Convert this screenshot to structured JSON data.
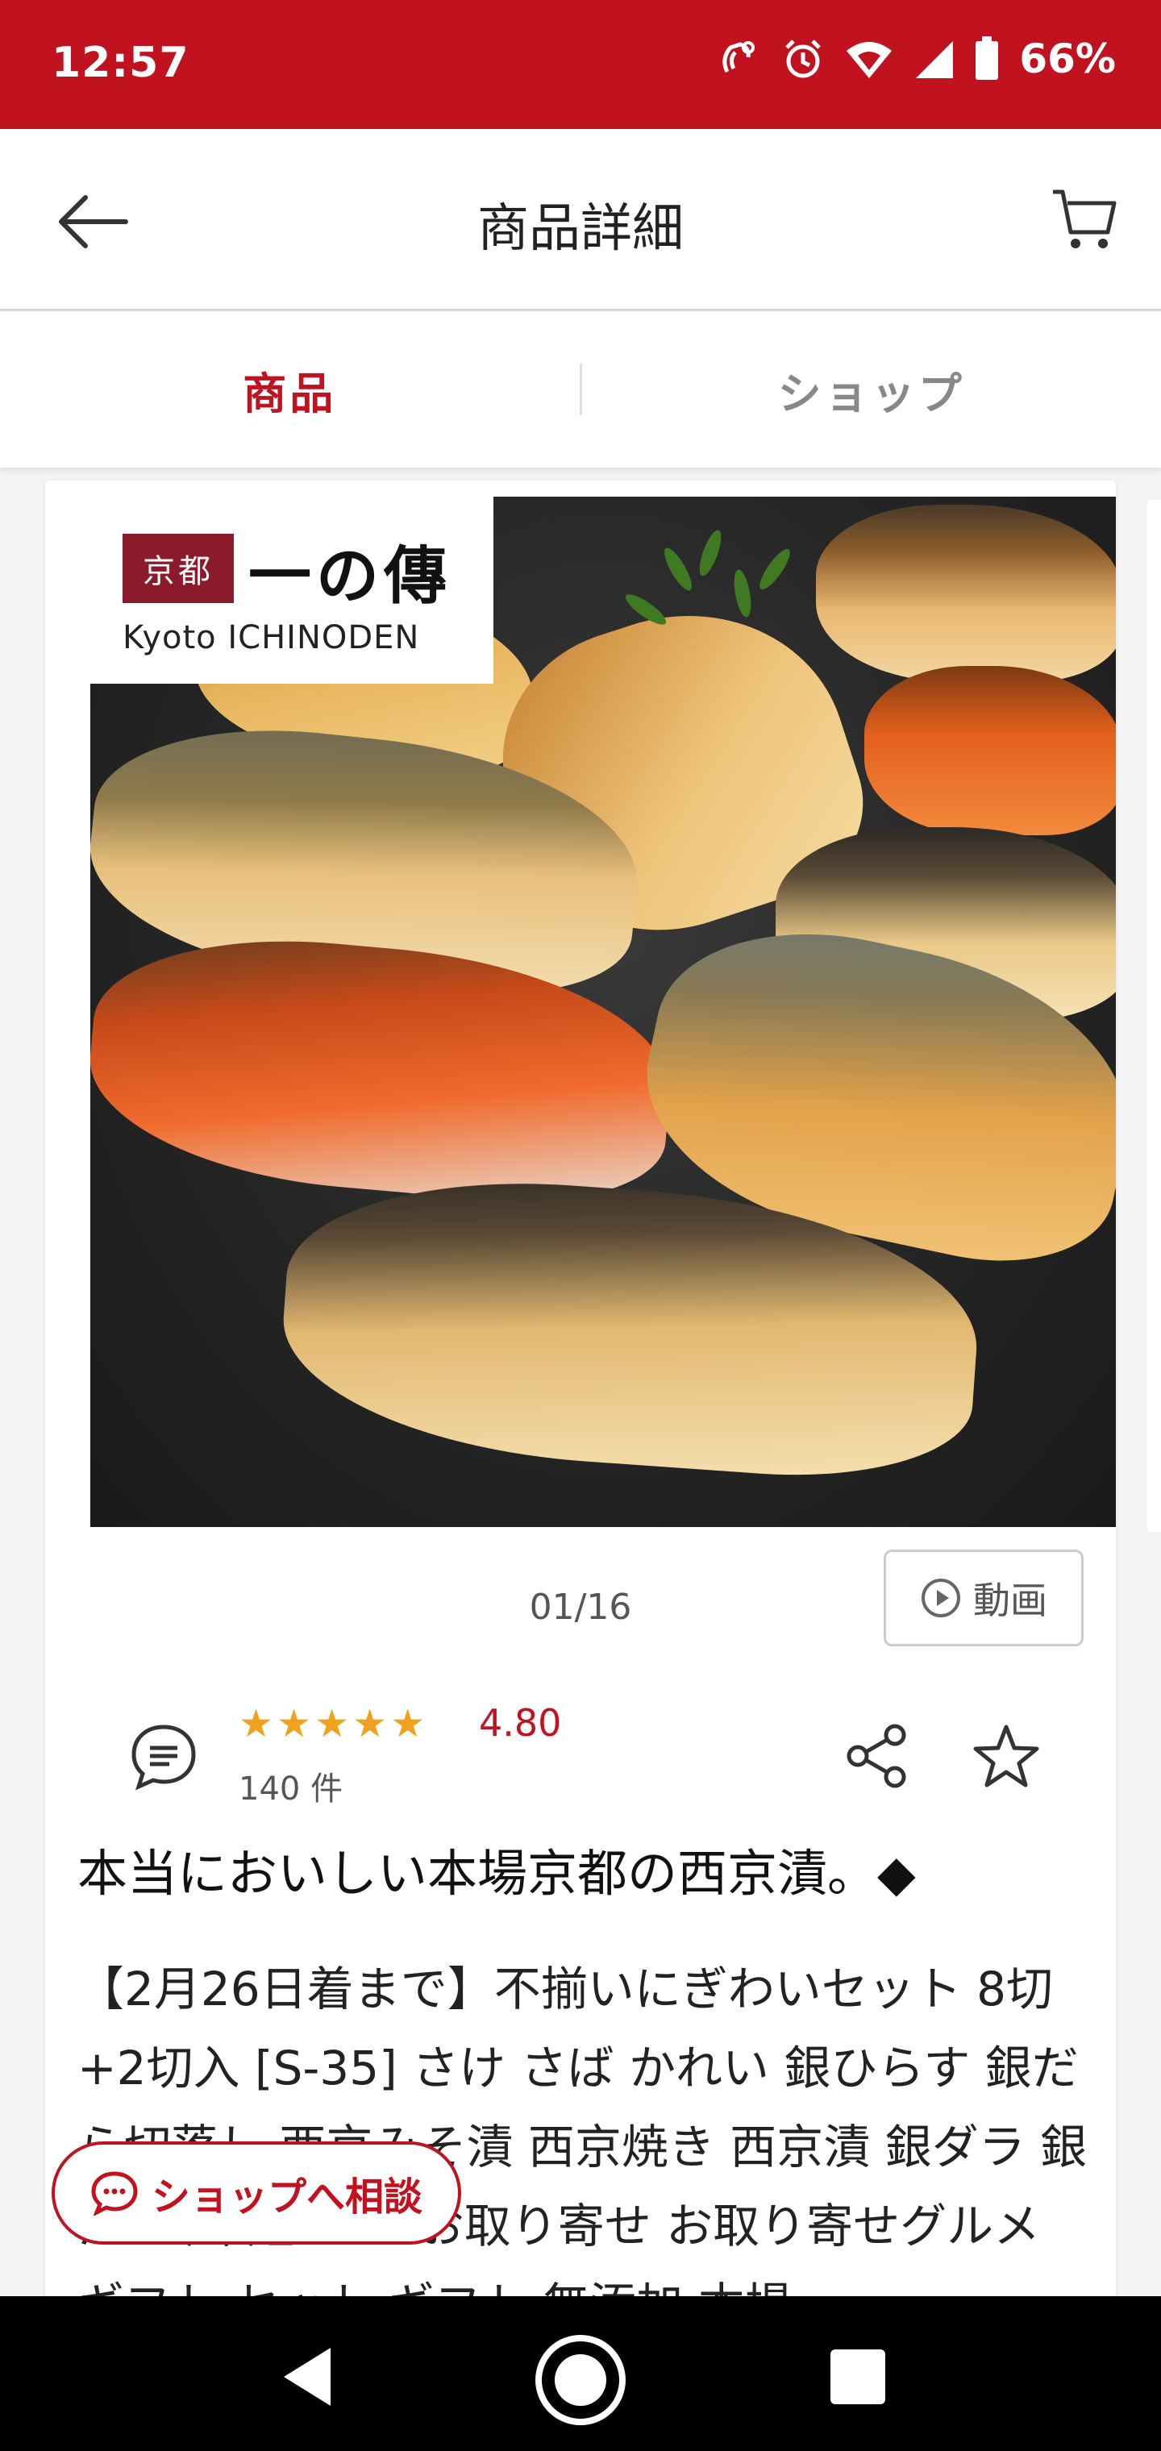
{
  "status_bar": {
    "time": "12:57",
    "battery": "66%",
    "icons": [
      "nfc-icon",
      "alarm-icon",
      "wifi-icon",
      "signal-icon",
      "battery-icon"
    ],
    "bg_color": "#c1121f"
  },
  "app_bar": {
    "title": "商品詳細",
    "back_icon": "arrow-left-icon",
    "cart_icon": "cart-icon"
  },
  "tabs": [
    {
      "label": "商品",
      "active": true
    },
    {
      "label": "ショップ",
      "active": false
    }
  ],
  "product": {
    "logo": {
      "badge": "京都",
      "name": "一の傳",
      "sub": "Kyoto ICHINODEN"
    },
    "pager": "01/16",
    "video_label": "動画",
    "rating": {
      "stars": 5,
      "value": "4.80",
      "count": "140 件"
    },
    "heading": "本当においしい本場京都の西京漬。◆",
    "description": "【2月26日着まで】不揃いにぎわいセット 8切+2切入 [S-35] さけ さば かれい 銀ひらす 銀だら切落し 西京みそ漬 西京焼き 西京漬 銀ダラ 銀だら 鱈 鮭 サケ お取り寄せ お取り寄せグルメ ギフト セット ギフト 無添加 本場"
  },
  "consult_button": {
    "label": "ショップへ相談"
  },
  "colors": {
    "accent": "#c1121f",
    "star": "#f0a21e"
  }
}
